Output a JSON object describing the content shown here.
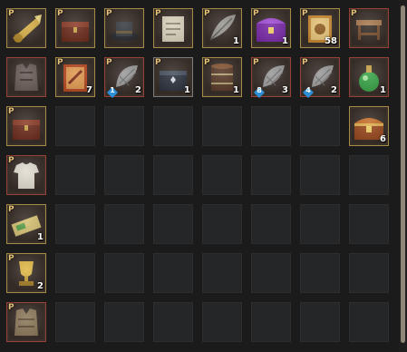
{
  "inventory": {
    "rows": [
      [
        {
          "icon": "golden-horn-icon",
          "border": "gold",
          "p": true
        },
        {
          "icon": "treasure-box-icon",
          "border": "gold",
          "p": true
        },
        {
          "icon": "dark-hat-icon",
          "border": "gold",
          "p": true
        },
        {
          "icon": "map-scroll-icon",
          "border": "gold",
          "p": true
        },
        {
          "icon": "feather-icon",
          "border": "gold",
          "p": true,
          "count": "1"
        },
        {
          "icon": "purple-chest-icon",
          "border": "gold",
          "p": true,
          "count": "1"
        },
        {
          "icon": "card-icon",
          "border": "gold",
          "p": true,
          "count": "58"
        },
        {
          "icon": "small-table-icon",
          "border": "red",
          "p": true
        }
      ],
      [
        {
          "icon": "armor-vest-icon",
          "border": "red",
          "p": false
        },
        {
          "icon": "red-card-icon",
          "border": "gold",
          "p": true,
          "count": "7"
        },
        {
          "icon": "grey-fishnet-icon",
          "border": "red",
          "p": true,
          "count": "2",
          "grade": "1"
        },
        {
          "icon": "dark-crate-icon",
          "border": "grey",
          "p": true,
          "count": "1"
        },
        {
          "icon": "drum-barrel-icon",
          "border": "gold",
          "p": true,
          "count": "1"
        },
        {
          "icon": "grey-fishnet-icon",
          "border": "red",
          "p": true,
          "count": "3",
          "grade": "8"
        },
        {
          "icon": "grey-fishnet-icon",
          "border": "red",
          "p": true,
          "count": "2",
          "grade": "4"
        },
        {
          "icon": "green-potion-icon",
          "border": "red",
          "p": false,
          "count": "1"
        }
      ],
      [
        {
          "icon": "treasure-box-icon",
          "border": "gold",
          "p": true
        },
        {
          "empty": true
        },
        {
          "empty": true
        },
        {
          "empty": true
        },
        {
          "empty": true
        },
        {
          "empty": true
        },
        {
          "empty": true
        },
        {
          "icon": "treasure-chest-icon",
          "border": "gold",
          "p": false,
          "count": "6"
        }
      ],
      [
        {
          "icon": "white-shirt-icon",
          "border": "red",
          "p": true
        },
        {
          "empty": true
        },
        {
          "empty": true
        },
        {
          "empty": true
        },
        {
          "empty": true
        },
        {
          "empty": true
        },
        {
          "empty": true
        },
        {
          "empty": true
        }
      ],
      [
        {
          "icon": "green-map-icon",
          "border": "gold",
          "p": true,
          "count": "1"
        },
        {
          "empty": true
        },
        {
          "empty": true
        },
        {
          "empty": true
        },
        {
          "empty": true
        },
        {
          "empty": true
        },
        {
          "empty": true
        },
        {
          "empty": true
        }
      ],
      [
        {
          "icon": "golden-trophy-icon",
          "border": "gold",
          "p": true,
          "count": "2"
        },
        {
          "empty": true
        },
        {
          "empty": true
        },
        {
          "empty": true
        },
        {
          "empty": true
        },
        {
          "empty": true
        },
        {
          "empty": true
        },
        {
          "empty": true
        }
      ],
      [
        {
          "icon": "leather-armor-icon",
          "border": "red",
          "p": true
        },
        {
          "empty": true
        },
        {
          "empty": true
        },
        {
          "empty": true
        },
        {
          "empty": true
        },
        {
          "empty": true
        },
        {
          "empty": true
        },
        {
          "empty": true
        }
      ]
    ],
    "p_label": "P"
  },
  "colors": {
    "gold_border": "#a88a48",
    "red_border": "#9a4037",
    "grade_badge": "#2e8fd6",
    "empty_slot": "#252627"
  }
}
